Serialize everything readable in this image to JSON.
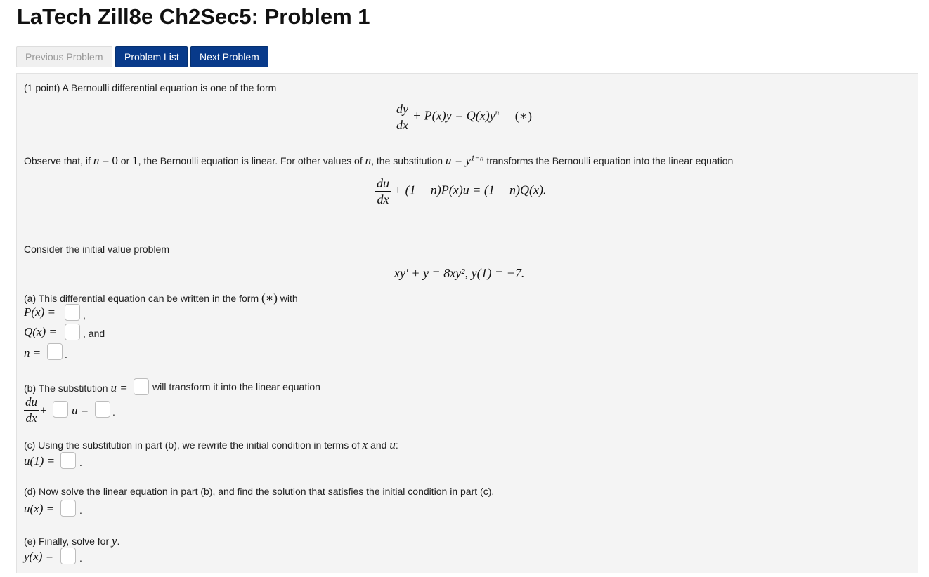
{
  "page": {
    "title": "LaTech Zill8e Ch2Sec5: Problem 1"
  },
  "nav": {
    "previous_label": "Previous Problem",
    "list_label": "Problem List",
    "next_label": "Next Problem"
  },
  "problem": {
    "intro": "(1 point) A Bernoulli differential equation is one of the form",
    "eq_bernoulli": "+ P(x)y = Q(x)y",
    "eq_bernoulli_exp": "n",
    "eq_bernoulli_tag": "(∗)",
    "frac_dy_num": "dy",
    "frac_dx_den": "dx",
    "observe_a": "Observe that, if ",
    "observe_n": "n",
    "observe_eq0": " = 0",
    "observe_or": " or ",
    "observe_one": "1",
    "observe_b": ", the Bernoulli equation is linear. For other values of ",
    "observe_n2": "n",
    "observe_c": ", the substitution ",
    "observe_sub": "u = y",
    "observe_sub_exp": "1−n",
    "observe_d": " transforms the Bernoulli equation into the linear equation",
    "frac_du_num": "du",
    "eq_linear": "+ (1 − n)P(x)u = (1 − n)Q(x).",
    "consider": "Consider the initial value problem",
    "ivp": "xy′ + y = 8xy², y(1) = −7.",
    "part_a_text": "(a) This differential equation can be written in the form ",
    "part_a_star": "(∗)",
    "part_a_with": " with",
    "P_label": "P(x) =",
    "Q_label": "Q(x) =",
    "n_label": "n =",
    "comma": ",",
    "and_text": ", and",
    "period": ".",
    "part_b_text": "(b) The substitution ",
    "part_b_u": "u =",
    "part_b_after": " will transform it into the linear equation",
    "part_b_plus": "+",
    "part_b_ueq": "u =",
    "part_c_text": "(c) Using the substitution in part (b), we rewrite the initial condition in terms of ",
    "part_c_x": "x",
    "part_c_and": " and ",
    "part_c_u": "u",
    "part_c_colon": ":",
    "u1_label": "u(1) =",
    "part_d_text": "(d) Now solve the linear equation in part (b), and find the solution that satisfies the initial condition in part (c).",
    "ux_label": "u(x) =",
    "part_e_text": "(e) Finally, solve for ",
    "part_e_y": "y",
    "part_e_period": ".",
    "yx_label": "y(x) ="
  }
}
